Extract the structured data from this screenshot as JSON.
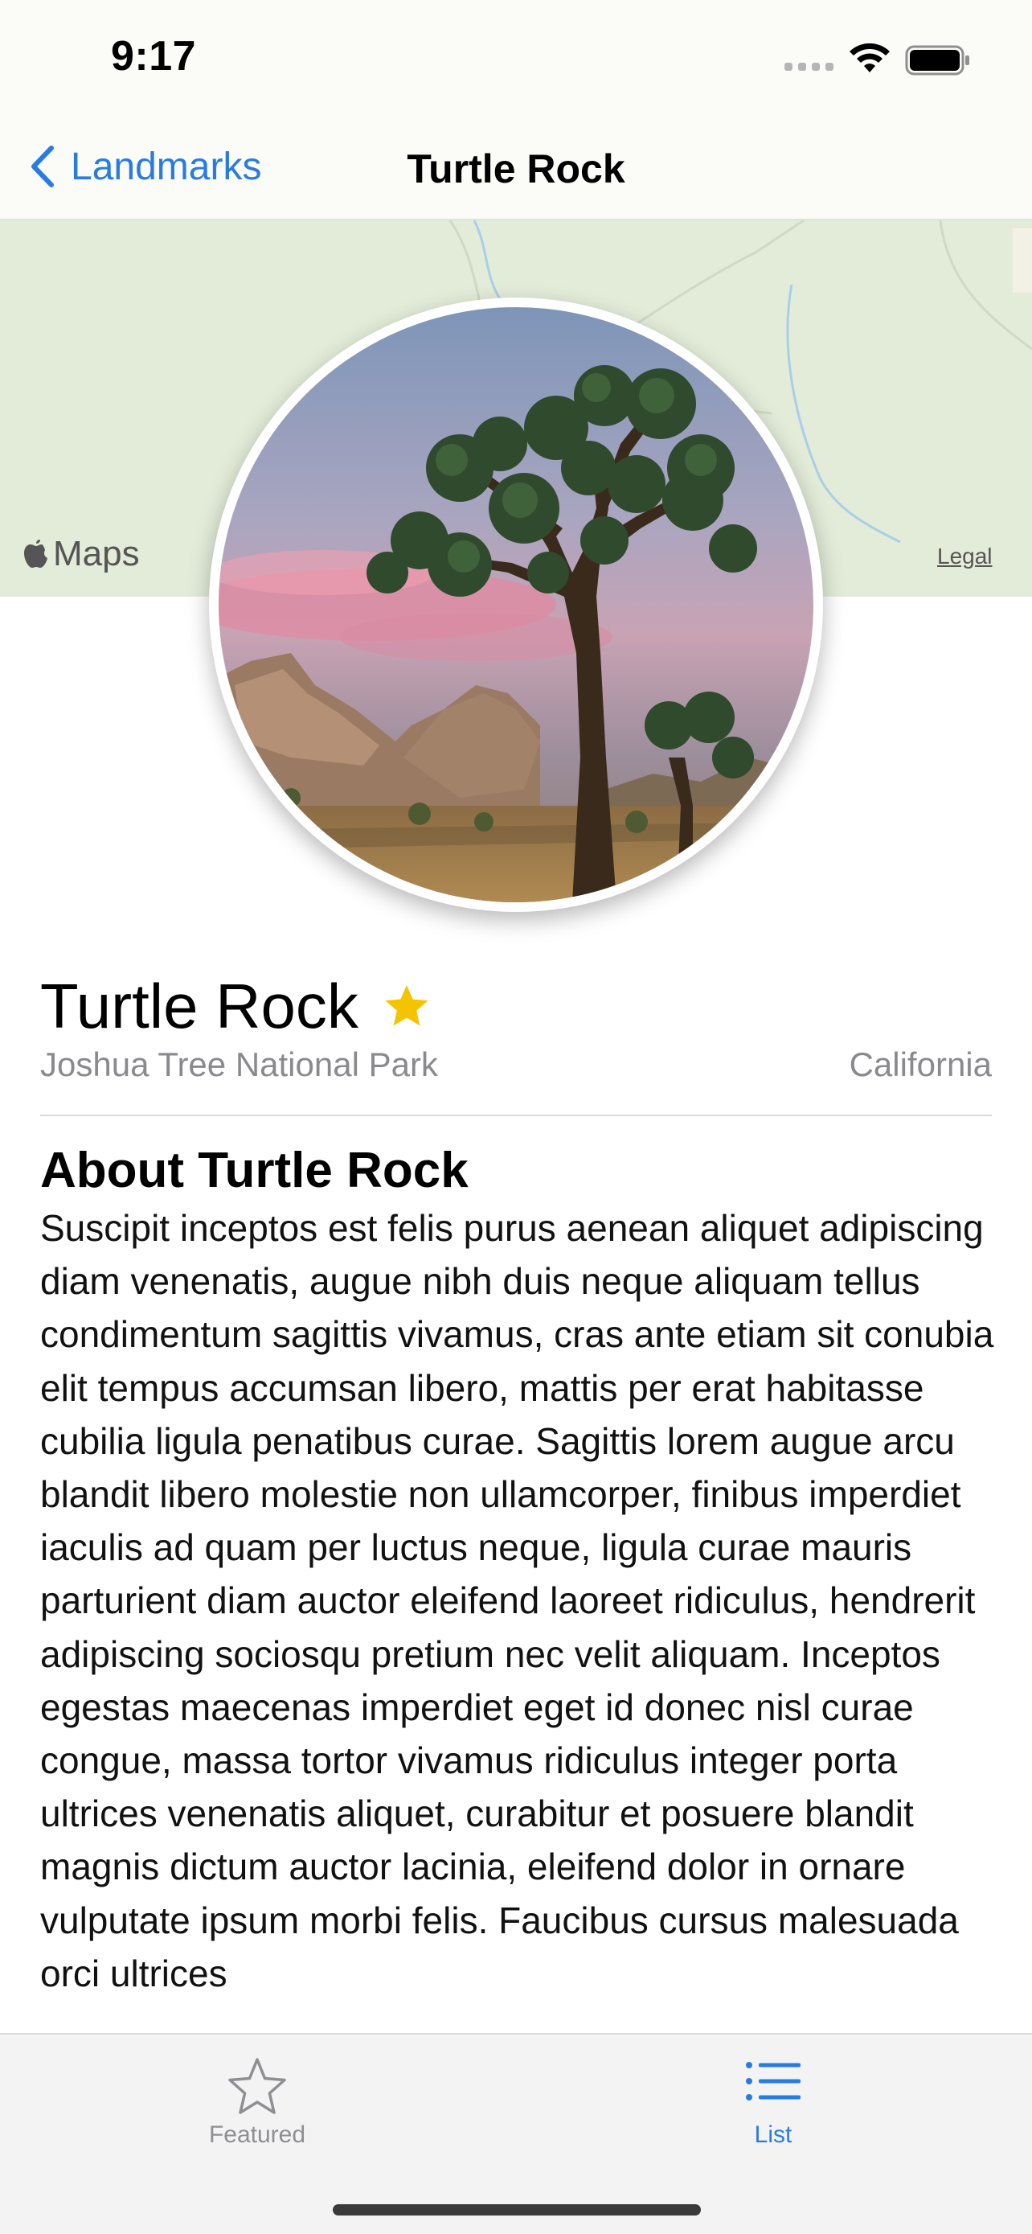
{
  "status_bar": {
    "time": "9:17"
  },
  "nav": {
    "back_label": "Landmarks",
    "title": "Turtle Rock"
  },
  "map": {
    "attribution": "Maps",
    "legal_label": "Legal"
  },
  "landmark": {
    "name": "Turtle Rock",
    "favorite": true,
    "park": "Joshua Tree National Park",
    "state": "California",
    "about_title": "About Turtle Rock",
    "description": "Suscipit inceptos est felis purus aenean aliquet adipiscing diam venenatis, augue nibh duis neque aliquam tellus condimentum sagittis vivamus, cras ante etiam sit conubia elit tempus accumsan libero, mattis per erat habitasse cubilia ligula penatibus curae. Sagittis lorem augue arcu blandit libero molestie non ullamcorper, finibus imperdiet iaculis ad quam per luctus neque, ligula curae mauris parturient diam auctor eleifend laoreet ridiculus, hendrerit adipiscing sociosqu pretium nec velit aliquam. Inceptos egestas maecenas imperdiet eget id donec nisl curae congue, massa tortor vivamus ridiculus integer porta ultrices venenatis aliquet, curabitur et posuere blandit magnis dictum auctor lacinia, eleifend dolor in ornare vulputate ipsum morbi felis. Faucibus cursus malesuada orci ultrices"
  },
  "tab_bar": {
    "tabs": [
      {
        "label": "Featured",
        "icon": "star-outline-icon",
        "selected": false
      },
      {
        "label": "List",
        "icon": "list-icon",
        "selected": true
      }
    ]
  },
  "colors": {
    "accent": "#2a7bdf",
    "favorite": "#f5c400",
    "secondary_text": "#8a8a8e",
    "map_land": "#e3ecd9"
  }
}
